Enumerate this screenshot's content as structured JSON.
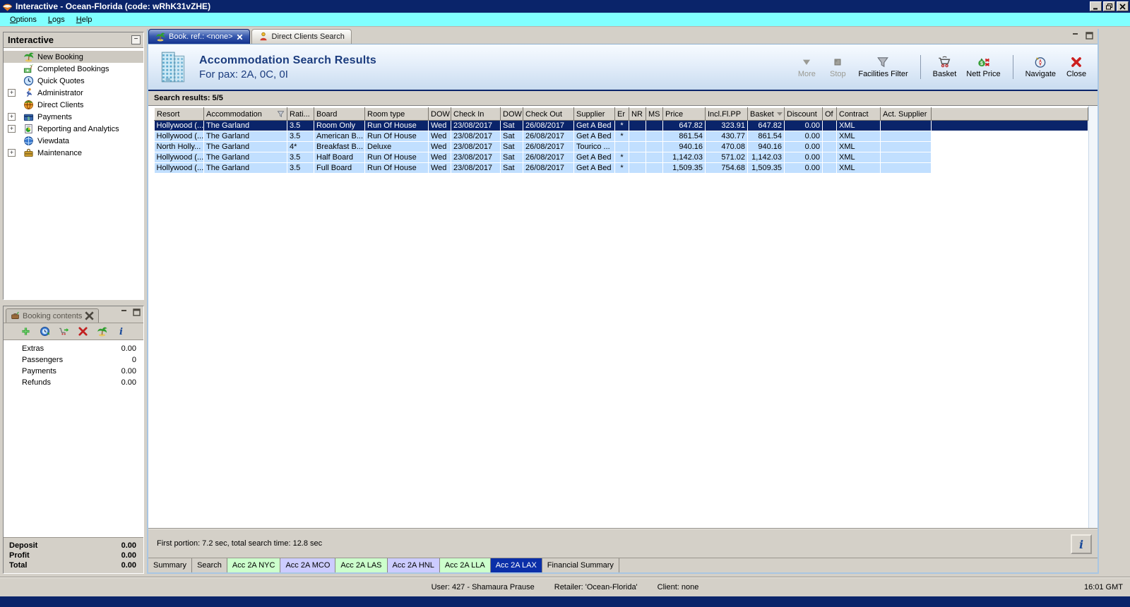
{
  "window": {
    "title": "Interactive - Ocean-Florida (code: wRhK31vZHE)",
    "clock": "16:01 GMT",
    "status": {
      "user": "User: 427 - Shamaura Prause",
      "retailer": "Retailer: 'Ocean-Florida'",
      "client": "Client: none"
    }
  },
  "menu_bar": {
    "items": [
      "Options",
      "Logs",
      "Help"
    ]
  },
  "sidebar": {
    "title": "Interactive",
    "items": [
      {
        "label": "New Booking",
        "icon": "palm-tree-icon",
        "expandable": false,
        "selected": true
      },
      {
        "label": "Completed Bookings",
        "icon": "completed-bookings-icon",
        "expandable": false,
        "selected": false
      },
      {
        "label": "Quick Quotes",
        "icon": "clock-icon",
        "expandable": false,
        "selected": false
      },
      {
        "label": "Administrator",
        "icon": "administrator-icon",
        "expandable": true,
        "selected": false
      },
      {
        "label": "Direct Clients",
        "icon": "direct-clients-icon",
        "expandable": false,
        "selected": false
      },
      {
        "label": "Payments",
        "icon": "payments-icon",
        "expandable": true,
        "selected": false
      },
      {
        "label": "Reporting and Analytics",
        "icon": "reporting-icon",
        "expandable": true,
        "selected": false
      },
      {
        "label": "Viewdata",
        "icon": "viewdata-icon",
        "expandable": false,
        "selected": false
      },
      {
        "label": "Maintenance",
        "icon": "maintenance-icon",
        "expandable": true,
        "selected": false
      }
    ]
  },
  "booking_contents": {
    "title": "Booking contents",
    "toolbar_icons": [
      "add-icon",
      "world-clock-icon",
      "basket-add-icon",
      "delete-icon",
      "palm-tree-icon",
      "info-icon"
    ],
    "rows": [
      {
        "label": "Extras",
        "value": "0.00"
      },
      {
        "label": "Passengers",
        "value": "0"
      },
      {
        "label": "Payments",
        "value": "0.00"
      },
      {
        "label": "Refunds",
        "value": "0.00"
      }
    ],
    "totals": [
      {
        "label": "Deposit",
        "value": "0.00"
      },
      {
        "label": "Profit",
        "value": "0.00"
      },
      {
        "label": "Total",
        "value": "0.00"
      }
    ]
  },
  "main": {
    "tabs": [
      {
        "label": "Book. ref.: <none>",
        "icon": "palm-tree-icon",
        "active": true,
        "closable": true
      },
      {
        "label": "Direct Clients Search",
        "icon": "person-icon",
        "active": false,
        "closable": false
      }
    ],
    "header": {
      "title": "Accommodation Search Results",
      "subtitle": "For pax: 2A, 0C, 0I",
      "icon": "building-icon"
    },
    "toolbar_groups": [
      [
        {
          "label": "More",
          "icon": "more-icon",
          "disabled": true
        },
        {
          "label": "Stop",
          "icon": "stop-icon",
          "disabled": true
        },
        {
          "label": "Facilities Filter",
          "icon": "funnel-icon",
          "disabled": false
        }
      ],
      [
        {
          "label": "Basket",
          "icon": "basket-icon",
          "disabled": false
        },
        {
          "label": "Nett Price",
          "icon": "nett-price-icon",
          "disabled": false
        }
      ],
      [
        {
          "label": "Navigate",
          "icon": "navigate-icon",
          "disabled": false
        },
        {
          "label": "Close",
          "icon": "close-red-icon",
          "disabled": false
        }
      ]
    ],
    "results_label": "Search results: 5/5",
    "table": {
      "columns": [
        "Resort",
        "Accommodation",
        "Rati...",
        "Board",
        "Room type",
        "DOW",
        "Check In",
        "DOW",
        "Check Out",
        "Supplier",
        "Er",
        "NR",
        "MS",
        "Price",
        "Incl.Fl.PP",
        "Basket",
        "Discount",
        "Of",
        "Contract",
        "Act. Supplier"
      ],
      "rows": [
        {
          "selected": true,
          "cells": [
            "Hollywood (...",
            "The Garland",
            "3.5",
            "Room Only",
            "Run Of House",
            "Wed",
            "23/08/2017",
            "Sat",
            "26/08/2017",
            "Get A Bed",
            "*",
            "",
            "",
            "647.82",
            "323.91",
            "647.82",
            "0.00",
            "",
            "XML",
            ""
          ]
        },
        {
          "selected": false,
          "cells": [
            "Hollywood (...",
            "The Garland",
            "3.5",
            "American B...",
            "Run Of House",
            "Wed",
            "23/08/2017",
            "Sat",
            "26/08/2017",
            "Get A Bed",
            "*",
            "",
            "",
            "861.54",
            "430.77",
            "861.54",
            "0.00",
            "",
            "XML",
            ""
          ]
        },
        {
          "selected": false,
          "cells": [
            "North Holly...",
            "The Garland",
            "4*",
            "Breakfast B...",
            "Deluxe",
            "Wed",
            "23/08/2017",
            "Sat",
            "26/08/2017",
            "Tourico ...",
            "",
            "",
            "",
            "940.16",
            "470.08",
            "940.16",
            "0.00",
            "",
            "XML",
            ""
          ]
        },
        {
          "selected": false,
          "cells": [
            "Hollywood (...",
            "The Garland",
            "3.5",
            "Half Board",
            "Run Of House",
            "Wed",
            "23/08/2017",
            "Sat",
            "26/08/2017",
            "Get A Bed",
            "*",
            "",
            "",
            "1,142.03",
            "571.02",
            "1,142.03",
            "0.00",
            "",
            "XML",
            ""
          ]
        },
        {
          "selected": false,
          "cells": [
            "Hollywood (...",
            "The Garland",
            "3.5",
            "Full Board",
            "Run Of House",
            "Wed",
            "23/08/2017",
            "Sat",
            "26/08/2017",
            "Get A Bed",
            "*",
            "",
            "",
            "1,509.35",
            "754.68",
            "1,509.35",
            "0.00",
            "",
            "XML",
            ""
          ]
        }
      ]
    },
    "search_status": "First portion: 7.2 sec, total search time: 12.8 sec",
    "bottom_tabs": [
      {
        "label": "Summary",
        "color": "default",
        "active": false
      },
      {
        "label": "Search",
        "color": "default",
        "active": false
      },
      {
        "label": "Acc 2A NYC",
        "color": "green",
        "active": false
      },
      {
        "label": "Acc 2A MCO",
        "color": "lavender",
        "active": false
      },
      {
        "label": "Acc 2A LAS",
        "color": "green",
        "active": false
      },
      {
        "label": "Acc 2A HNL",
        "color": "lavender",
        "active": false
      },
      {
        "label": "Acc 2A LLA",
        "color": "green",
        "active": false
      },
      {
        "label": "Acc 2A LAX",
        "color": "navy",
        "active": true
      },
      {
        "label": "Financial Summary",
        "color": "default",
        "active": false
      }
    ]
  },
  "colors": {
    "titlebar": "#0a246a",
    "menubar": "#80ffff",
    "chrome": "#d4d0c8",
    "selected_row": "#0a246a",
    "row_blue": "#c1dfff",
    "tab_green": "#ccffcc",
    "tab_lavender": "#ccccff",
    "tab_navy": "#0b2fa8",
    "header_text": "#1b3c7e"
  }
}
